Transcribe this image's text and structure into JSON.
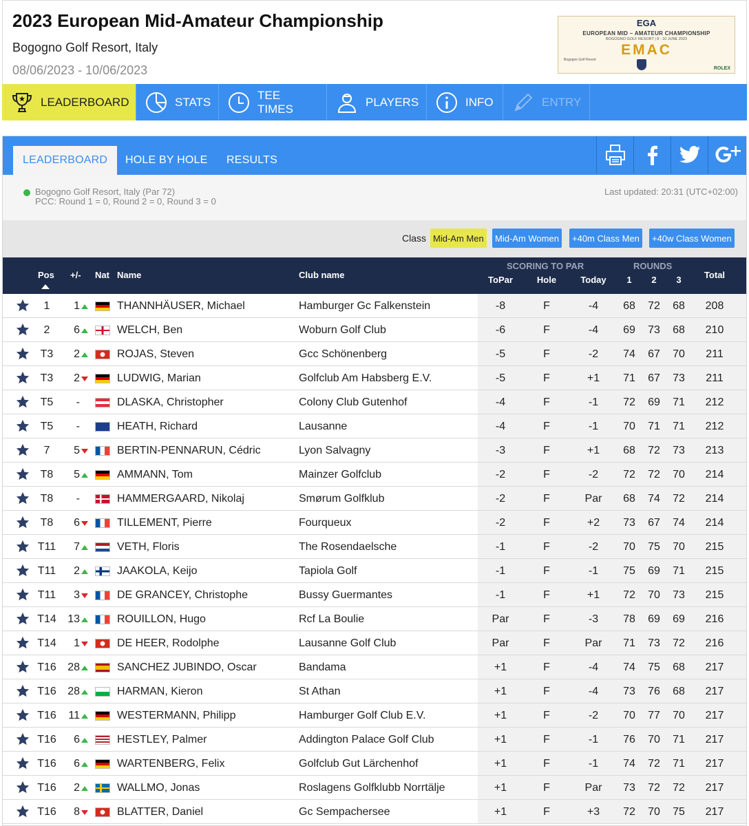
{
  "header": {
    "title": "2023 European Mid-Amateur Championship",
    "venue": "Bogogno Golf Resort, Italy",
    "dates": "08/06/2023 - 10/06/2023",
    "logo": {
      "line1": "EGA",
      "line2": "EUROPEAN MID – AMATEUR CHAMPIONSHIP",
      "line3": "BOGOGNO GOLF RESORT | 8 - 10 JUNE 2023",
      "line4": "EMAC",
      "left_mark": "Bogogno Golf Resort",
      "right_mark": "ROLEX"
    }
  },
  "main_nav": [
    {
      "label": "LEADERBOARD",
      "icon": "trophy-icon",
      "active": true
    },
    {
      "label": "STATS",
      "icon": "pie-chart-icon"
    },
    {
      "label": "TEE TIMES",
      "icon": "clock-icon"
    },
    {
      "label": "PLAYERS",
      "icon": "player-icon"
    },
    {
      "label": "INFO",
      "icon": "info-icon"
    },
    {
      "label": "ENTRY",
      "icon": "pencil-icon",
      "disabled": true
    }
  ],
  "tabs": [
    "LEADERBOARD",
    "HOLE BY HOLE",
    "RESULTS"
  ],
  "share_icons": [
    "print-icon",
    "facebook-icon",
    "twitter-icon",
    "google-plus-icon"
  ],
  "info": {
    "course": "Bogogno Golf Resort, Italy (Par 72)",
    "pcc": "PCC: Round 1 = 0, Round 2 = 0, Round 3 = 0",
    "updated": "Last updated: 20:31 (UTC+02:00)"
  },
  "class_filter": {
    "label": "Class",
    "options": [
      "Mid-Am Men",
      "Mid-Am Women",
      "+40m Class Men",
      "+40w Class Women"
    ],
    "selected": "Mid-Am Men"
  },
  "columns": {
    "pos": "Pos",
    "change": "+/-",
    "nat": "Nat",
    "name": "Name",
    "club": "Club name",
    "scoring_group": "SCORING TO PAR",
    "topar": "ToPar",
    "hole": "Hole",
    "today": "Today",
    "rounds_group": "ROUNDS",
    "r1": "1",
    "r2": "2",
    "r3": "3",
    "total": "Total"
  },
  "colors": {
    "accent": "#3a8eef",
    "highlight": "#e7e74a",
    "header_dark": "#1e2c4b",
    "up": "#3cb64a",
    "down": "#d9262b"
  },
  "rows": [
    {
      "pos": "1",
      "change": "1",
      "dir": "up",
      "nat": "GER",
      "name": "THANNHÄUSER, Michael",
      "club": "Hamburger Gc Falkenstein",
      "topar": "-8",
      "hole": "F",
      "today": "-4",
      "r1": "68",
      "r2": "72",
      "r3": "68",
      "total": "208"
    },
    {
      "pos": "2",
      "change": "6",
      "dir": "up",
      "nat": "ENG",
      "name": "WELCH, Ben",
      "club": "Woburn Golf Club",
      "topar": "-6",
      "hole": "F",
      "today": "-4",
      "r1": "69",
      "r2": "73",
      "r3": "68",
      "total": "210"
    },
    {
      "pos": "T3",
      "change": "2",
      "dir": "up",
      "nat": "SUI",
      "name": "ROJAS, Steven",
      "club": "Gcc Schönenberg",
      "topar": "-5",
      "hole": "F",
      "today": "-2",
      "r1": "74",
      "r2": "67",
      "r3": "70",
      "total": "211"
    },
    {
      "pos": "T3",
      "change": "2",
      "dir": "down",
      "nat": "GER",
      "name": "LUDWIG, Marian",
      "club": "Golfclub Am Habsberg E.V.",
      "topar": "-5",
      "hole": "F",
      "today": "+1",
      "r1": "71",
      "r2": "67",
      "r3": "73",
      "total": "211"
    },
    {
      "pos": "T5",
      "change": "-",
      "dir": "",
      "nat": "AUT",
      "name": "DLASKA, Christopher",
      "club": "Colony Club Gutenhof",
      "topar": "-4",
      "hole": "F",
      "today": "-1",
      "r1": "72",
      "r2": "69",
      "r3": "71",
      "total": "212"
    },
    {
      "pos": "T5",
      "change": "-",
      "dir": "",
      "nat": "AUS",
      "name": "HEATH, Richard",
      "club": "Lausanne",
      "topar": "-4",
      "hole": "F",
      "today": "-1",
      "r1": "70",
      "r2": "71",
      "r3": "71",
      "total": "212"
    },
    {
      "pos": "7",
      "change": "5",
      "dir": "down",
      "nat": "FRA",
      "name": "BERTIN-PENNARUN, Cédric",
      "club": "Lyon Salvagny",
      "topar": "-3",
      "hole": "F",
      "today": "+1",
      "r1": "68",
      "r2": "72",
      "r3": "73",
      "total": "213"
    },
    {
      "pos": "T8",
      "change": "5",
      "dir": "up",
      "nat": "GER",
      "name": "AMMANN, Tom",
      "club": "Mainzer Golfclub",
      "topar": "-2",
      "hole": "F",
      "today": "-2",
      "r1": "72",
      "r2": "72",
      "r3": "70",
      "total": "214"
    },
    {
      "pos": "T8",
      "change": "-",
      "dir": "",
      "nat": "DEN",
      "name": "HAMMERGAARD, Nikolaj",
      "club": "Smørum Golfklub",
      "topar": "-2",
      "hole": "F",
      "today": "Par",
      "r1": "68",
      "r2": "74",
      "r3": "72",
      "total": "214"
    },
    {
      "pos": "T8",
      "change": "6",
      "dir": "down",
      "nat": "FRA",
      "name": "TILLEMENT, Pierre",
      "club": "Fourqueux",
      "topar": "-2",
      "hole": "F",
      "today": "+2",
      "r1": "73",
      "r2": "67",
      "r3": "74",
      "total": "214"
    },
    {
      "pos": "T11",
      "change": "7",
      "dir": "up",
      "nat": "NED",
      "name": "VETH, Floris",
      "club": "The Rosendaelsche",
      "topar": "-1",
      "hole": "F",
      "today": "-2",
      "r1": "70",
      "r2": "75",
      "r3": "70",
      "total": "215"
    },
    {
      "pos": "T11",
      "change": "2",
      "dir": "up",
      "nat": "FIN",
      "name": "JAAKOLA, Keijo",
      "club": "Tapiola Golf",
      "topar": "-1",
      "hole": "F",
      "today": "-1",
      "r1": "75",
      "r2": "69",
      "r3": "71",
      "total": "215"
    },
    {
      "pos": "T11",
      "change": "3",
      "dir": "down",
      "nat": "FRA",
      "name": "DE GRANCEY, Christophe",
      "club": "Bussy Guermantes",
      "topar": "-1",
      "hole": "F",
      "today": "+1",
      "r1": "72",
      "r2": "70",
      "r3": "73",
      "total": "215"
    },
    {
      "pos": "T14",
      "change": "13",
      "dir": "up",
      "nat": "FRA",
      "name": "ROUILLON, Hugo",
      "club": "Rcf La Boulie",
      "topar": "Par",
      "hole": "F",
      "today": "-3",
      "r1": "78",
      "r2": "69",
      "r3": "69",
      "total": "216"
    },
    {
      "pos": "T14",
      "change": "1",
      "dir": "down",
      "nat": "SUI",
      "name": "DE HEER, Rodolphe",
      "club": "Lausanne Golf Club",
      "topar": "Par",
      "hole": "F",
      "today": "Par",
      "r1": "71",
      "r2": "73",
      "r3": "72",
      "total": "216"
    },
    {
      "pos": "T16",
      "change": "28",
      "dir": "up",
      "nat": "ESP",
      "name": "SANCHEZ JUBINDO, Oscar",
      "club": "Bandama",
      "topar": "+1",
      "hole": "F",
      "today": "-4",
      "r1": "74",
      "r2": "75",
      "r3": "68",
      "total": "217"
    },
    {
      "pos": "T16",
      "change": "28",
      "dir": "up",
      "nat": "WAL",
      "name": "HARMAN, Kieron",
      "club": "St Athan",
      "topar": "+1",
      "hole": "F",
      "today": "-4",
      "r1": "73",
      "r2": "76",
      "r3": "68",
      "total": "217"
    },
    {
      "pos": "T16",
      "change": "11",
      "dir": "up",
      "nat": "GER",
      "name": "WESTERMANN, Philipp",
      "club": "Hamburger Golf Club E.V.",
      "topar": "+1",
      "hole": "F",
      "today": "-2",
      "r1": "70",
      "r2": "77",
      "r3": "70",
      "total": "217"
    },
    {
      "pos": "T16",
      "change": "6",
      "dir": "up",
      "nat": "USA",
      "name": "HESTLEY, Palmer",
      "club": "Addington Palace Golf Club",
      "topar": "+1",
      "hole": "F",
      "today": "-1",
      "r1": "76",
      "r2": "70",
      "r3": "71",
      "total": "217"
    },
    {
      "pos": "T16",
      "change": "6",
      "dir": "up",
      "nat": "GER",
      "name": "WARTENBERG, Felix",
      "club": "Golfclub Gut Lärchenhof",
      "topar": "+1",
      "hole": "F",
      "today": "-1",
      "r1": "74",
      "r2": "72",
      "r3": "71",
      "total": "217"
    },
    {
      "pos": "T16",
      "change": "2",
      "dir": "up",
      "nat": "SWE",
      "name": "WALLMO, Jonas",
      "club": "Roslagens Golfklubb Norrtälje",
      "topar": "+1",
      "hole": "F",
      "today": "Par",
      "r1": "73",
      "r2": "72",
      "r3": "72",
      "total": "217"
    },
    {
      "pos": "T16",
      "change": "8",
      "dir": "down",
      "nat": "SUI",
      "name": "BLATTER, Daniel",
      "club": "Gc Sempachersee",
      "topar": "+1",
      "hole": "F",
      "today": "+3",
      "r1": "72",
      "r2": "70",
      "r3": "75",
      "total": "217"
    }
  ]
}
